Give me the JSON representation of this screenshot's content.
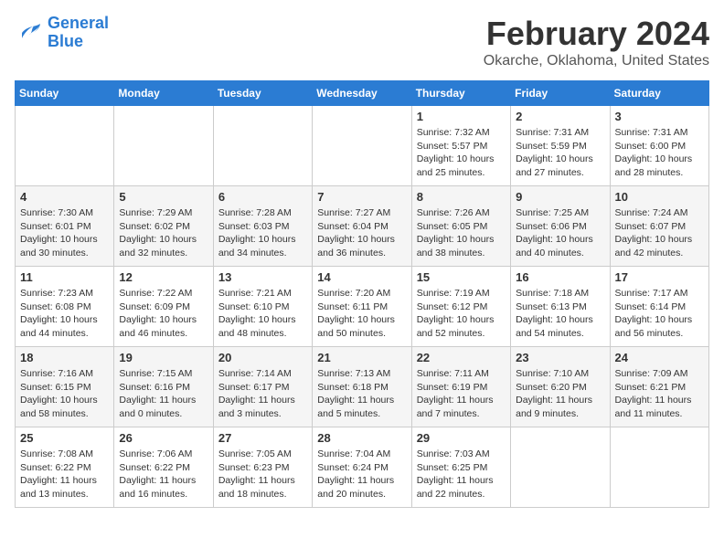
{
  "header": {
    "logo_line1": "General",
    "logo_line2": "Blue",
    "month": "February 2024",
    "location": "Okarche, Oklahoma, United States"
  },
  "days_of_week": [
    "Sunday",
    "Monday",
    "Tuesday",
    "Wednesday",
    "Thursday",
    "Friday",
    "Saturday"
  ],
  "weeks": [
    [
      {
        "num": "",
        "info": ""
      },
      {
        "num": "",
        "info": ""
      },
      {
        "num": "",
        "info": ""
      },
      {
        "num": "",
        "info": ""
      },
      {
        "num": "1",
        "info": "Sunrise: 7:32 AM\nSunset: 5:57 PM\nDaylight: 10 hours\nand 25 minutes."
      },
      {
        "num": "2",
        "info": "Sunrise: 7:31 AM\nSunset: 5:59 PM\nDaylight: 10 hours\nand 27 minutes."
      },
      {
        "num": "3",
        "info": "Sunrise: 7:31 AM\nSunset: 6:00 PM\nDaylight: 10 hours\nand 28 minutes."
      }
    ],
    [
      {
        "num": "4",
        "info": "Sunrise: 7:30 AM\nSunset: 6:01 PM\nDaylight: 10 hours\nand 30 minutes."
      },
      {
        "num": "5",
        "info": "Sunrise: 7:29 AM\nSunset: 6:02 PM\nDaylight: 10 hours\nand 32 minutes."
      },
      {
        "num": "6",
        "info": "Sunrise: 7:28 AM\nSunset: 6:03 PM\nDaylight: 10 hours\nand 34 minutes."
      },
      {
        "num": "7",
        "info": "Sunrise: 7:27 AM\nSunset: 6:04 PM\nDaylight: 10 hours\nand 36 minutes."
      },
      {
        "num": "8",
        "info": "Sunrise: 7:26 AM\nSunset: 6:05 PM\nDaylight: 10 hours\nand 38 minutes."
      },
      {
        "num": "9",
        "info": "Sunrise: 7:25 AM\nSunset: 6:06 PM\nDaylight: 10 hours\nand 40 minutes."
      },
      {
        "num": "10",
        "info": "Sunrise: 7:24 AM\nSunset: 6:07 PM\nDaylight: 10 hours\nand 42 minutes."
      }
    ],
    [
      {
        "num": "11",
        "info": "Sunrise: 7:23 AM\nSunset: 6:08 PM\nDaylight: 10 hours\nand 44 minutes."
      },
      {
        "num": "12",
        "info": "Sunrise: 7:22 AM\nSunset: 6:09 PM\nDaylight: 10 hours\nand 46 minutes."
      },
      {
        "num": "13",
        "info": "Sunrise: 7:21 AM\nSunset: 6:10 PM\nDaylight: 10 hours\nand 48 minutes."
      },
      {
        "num": "14",
        "info": "Sunrise: 7:20 AM\nSunset: 6:11 PM\nDaylight: 10 hours\nand 50 minutes."
      },
      {
        "num": "15",
        "info": "Sunrise: 7:19 AM\nSunset: 6:12 PM\nDaylight: 10 hours\nand 52 minutes."
      },
      {
        "num": "16",
        "info": "Sunrise: 7:18 AM\nSunset: 6:13 PM\nDaylight: 10 hours\nand 54 minutes."
      },
      {
        "num": "17",
        "info": "Sunrise: 7:17 AM\nSunset: 6:14 PM\nDaylight: 10 hours\nand 56 minutes."
      }
    ],
    [
      {
        "num": "18",
        "info": "Sunrise: 7:16 AM\nSunset: 6:15 PM\nDaylight: 10 hours\nand 58 minutes."
      },
      {
        "num": "19",
        "info": "Sunrise: 7:15 AM\nSunset: 6:16 PM\nDaylight: 11 hours\nand 0 minutes."
      },
      {
        "num": "20",
        "info": "Sunrise: 7:14 AM\nSunset: 6:17 PM\nDaylight: 11 hours\nand 3 minutes."
      },
      {
        "num": "21",
        "info": "Sunrise: 7:13 AM\nSunset: 6:18 PM\nDaylight: 11 hours\nand 5 minutes."
      },
      {
        "num": "22",
        "info": "Sunrise: 7:11 AM\nSunset: 6:19 PM\nDaylight: 11 hours\nand 7 minutes."
      },
      {
        "num": "23",
        "info": "Sunrise: 7:10 AM\nSunset: 6:20 PM\nDaylight: 11 hours\nand 9 minutes."
      },
      {
        "num": "24",
        "info": "Sunrise: 7:09 AM\nSunset: 6:21 PM\nDaylight: 11 hours\nand 11 minutes."
      }
    ],
    [
      {
        "num": "25",
        "info": "Sunrise: 7:08 AM\nSunset: 6:22 PM\nDaylight: 11 hours\nand 13 minutes."
      },
      {
        "num": "26",
        "info": "Sunrise: 7:06 AM\nSunset: 6:22 PM\nDaylight: 11 hours\nand 16 minutes."
      },
      {
        "num": "27",
        "info": "Sunrise: 7:05 AM\nSunset: 6:23 PM\nDaylight: 11 hours\nand 18 minutes."
      },
      {
        "num": "28",
        "info": "Sunrise: 7:04 AM\nSunset: 6:24 PM\nDaylight: 11 hours\nand 20 minutes."
      },
      {
        "num": "29",
        "info": "Sunrise: 7:03 AM\nSunset: 6:25 PM\nDaylight: 11 hours\nand 22 minutes."
      },
      {
        "num": "",
        "info": ""
      },
      {
        "num": "",
        "info": ""
      }
    ]
  ]
}
